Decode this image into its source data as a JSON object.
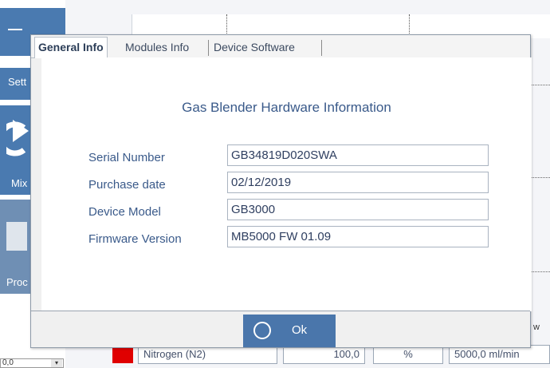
{
  "background": {
    "sidebar": {
      "settings_label": "Sett",
      "mix_label": "Mix",
      "process_label": "Proc"
    },
    "gas_row": {
      "gas_name": "Nitrogen (N2)",
      "amount": "100,0",
      "unit": "%",
      "flow": "5000,0 ml/min",
      "flow_header": "w",
      "stepper_value": "0,0"
    },
    "colors": {
      "accent": "#4a76ab",
      "gas_swatch": "#e00000"
    }
  },
  "dialog": {
    "tabs": [
      {
        "label": "General Info",
        "active": true
      },
      {
        "label": "Modules Info",
        "active": false
      },
      {
        "label": "Device Software",
        "active": false
      }
    ],
    "heading": "Gas Blender Hardware Information",
    "fields": [
      {
        "label": "Serial Number",
        "value": "GB34819D020SWA"
      },
      {
        "label": "Purchase date",
        "value": "02/12/2019"
      },
      {
        "label": "Device Model",
        "value": "GB3000"
      },
      {
        "label": "Firmware Version",
        "value": "MB5000 FW 01.09"
      }
    ],
    "ok_button": {
      "label": "Ok",
      "icon": "circle-icon"
    }
  }
}
